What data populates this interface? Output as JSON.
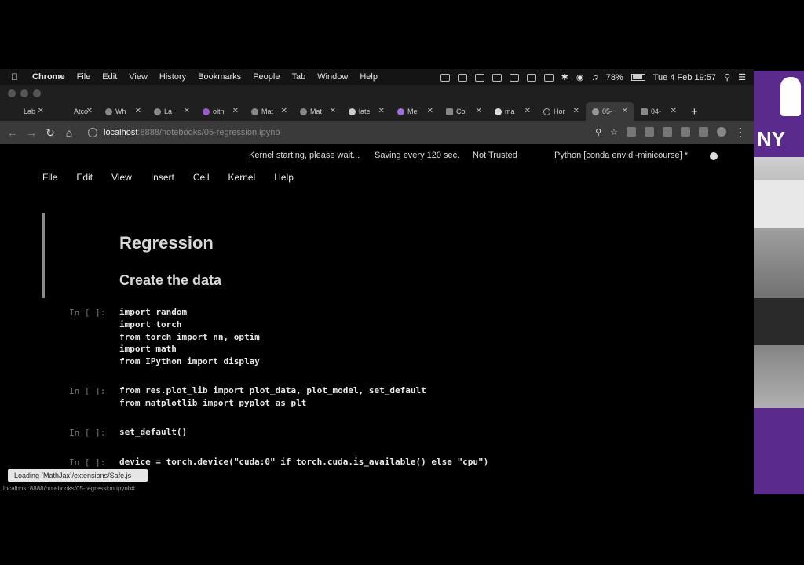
{
  "menubar": {
    "items": [
      "Chrome",
      "File",
      "Edit",
      "View",
      "History",
      "Bookmarks",
      "People",
      "Tab",
      "Window",
      "Help"
    ],
    "battery": "78%",
    "datetime": "Tue 4 Feb  19:57"
  },
  "tabs": [
    {
      "label": "Lab"
    },
    {
      "label": "Atco"
    },
    {
      "label": "Wh"
    },
    {
      "label": "La"
    },
    {
      "label": "oltn"
    },
    {
      "label": "Mat"
    },
    {
      "label": "Mat"
    },
    {
      "label": "late"
    },
    {
      "label": "Me"
    },
    {
      "label": "Col"
    },
    {
      "label": "ma"
    },
    {
      "label": "Hor"
    },
    {
      "label": "05-"
    },
    {
      "label": "04-"
    }
  ],
  "toolbar": {
    "host": "localhost",
    "path": ":8888/notebooks/05-regression.ipynb"
  },
  "jupyter": {
    "kernel_msg": "Kernel starting, please wait...",
    "autosave": "Saving every 120 sec.",
    "trust": "Not Trusted",
    "kernel_name": "Python [conda env:dl-minicourse] *",
    "menu": [
      "File",
      "Edit",
      "View",
      "Insert",
      "Cell",
      "Kernel",
      "Help"
    ],
    "heading1": "Regression",
    "heading2": "Create the data",
    "prompt": "In [ ]:",
    "cells": [
      "import random\nimport torch\nfrom torch import nn, optim\nimport math\nfrom IPython import display",
      "from res.plot_lib import plot_data, plot_model, set_default\nfrom matplotlib import pyplot as plt",
      "set_default()",
      "device = torch.device(\"cuda:0\" if torch.cuda.is_available() else \"cpu\")"
    ]
  },
  "status": {
    "loading": "Loading [MathJax]/extensions/Safe.js",
    "url_hint": "localhost:8888/notebooks/05-regression.ipynb#"
  },
  "video": {
    "logo": "NY"
  }
}
